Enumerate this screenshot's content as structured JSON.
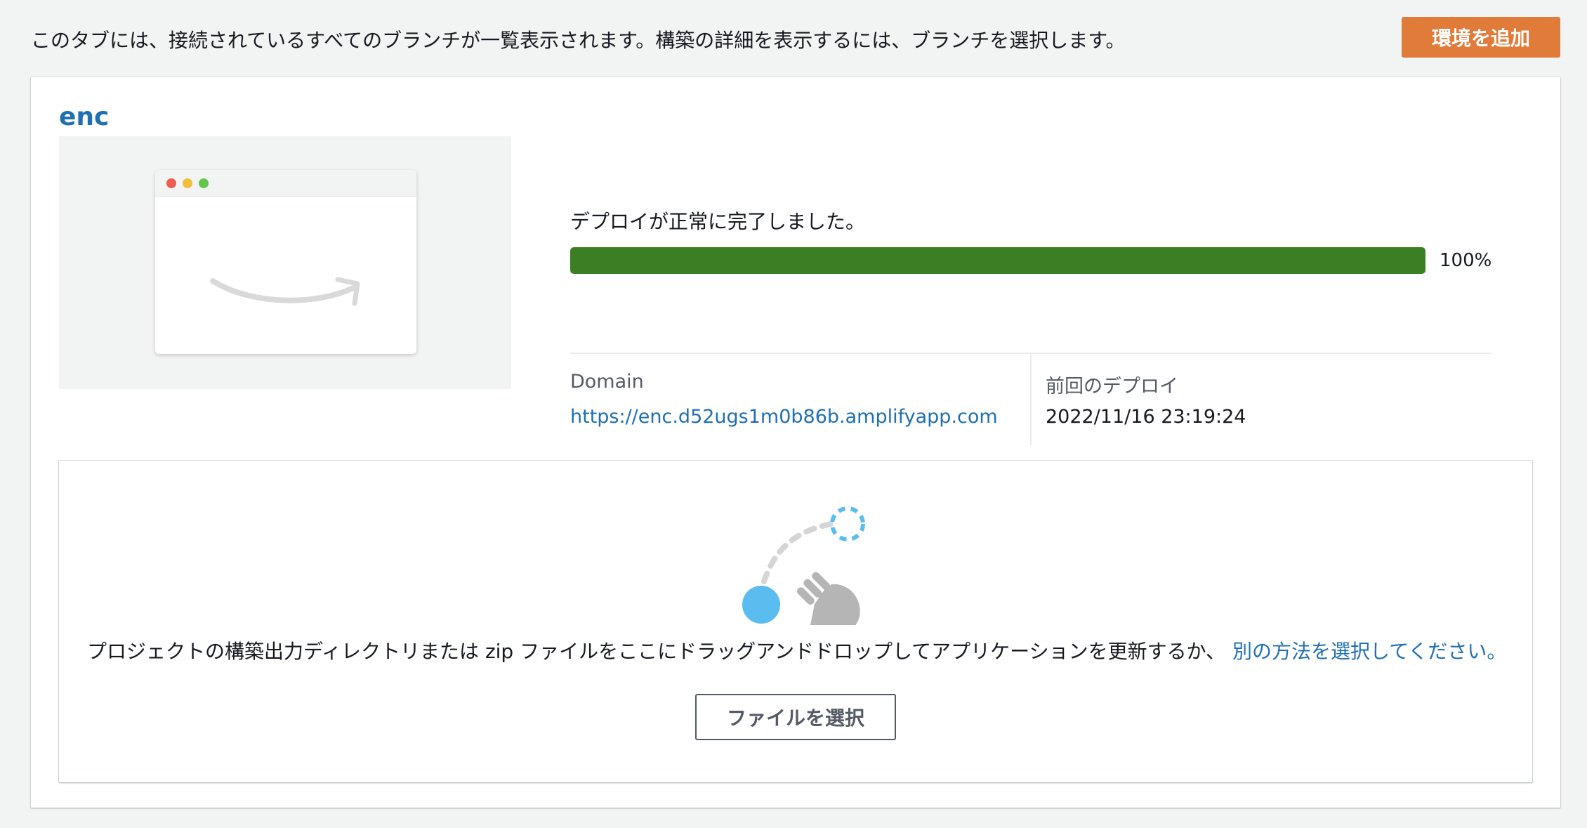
{
  "header": {
    "intro_text": "このタブには、接続されているすべてのブランチが一覧表示されます。構築の詳細を表示するには、ブランチを選択します。",
    "add_environment_label": "環境を追加"
  },
  "branch": {
    "name": "enc",
    "status_text": "デプロイが正常に完了しました。",
    "progress_percent": 100,
    "progress_label": "100%",
    "domain_label": "Domain",
    "domain_url": "https://enc.d52ugs1m0b86b.amplifyapp.com",
    "last_deploy_label": "前回のデプロイ",
    "last_deploy_value": "2022/11/16 23:19:24"
  },
  "dropzone": {
    "instruction_text": "プロジェクトの構築出力ディレクトリまたは zip ファイルをここにドラッグアンドドロップしてアプリケーションを更新するか、",
    "alternative_link": "別の方法を選択してください。",
    "choose_file_label": "ファイルを選択"
  },
  "colors": {
    "accent_button": "#e07b39",
    "link": "#1f6fb2",
    "progress": "#3b7e23",
    "drag_blue": "#5bbdef"
  },
  "icons": {
    "preview": "browser-window-icon",
    "logo": "amazon-smile-icon",
    "drag": "drag-and-drop-hand-icon"
  }
}
